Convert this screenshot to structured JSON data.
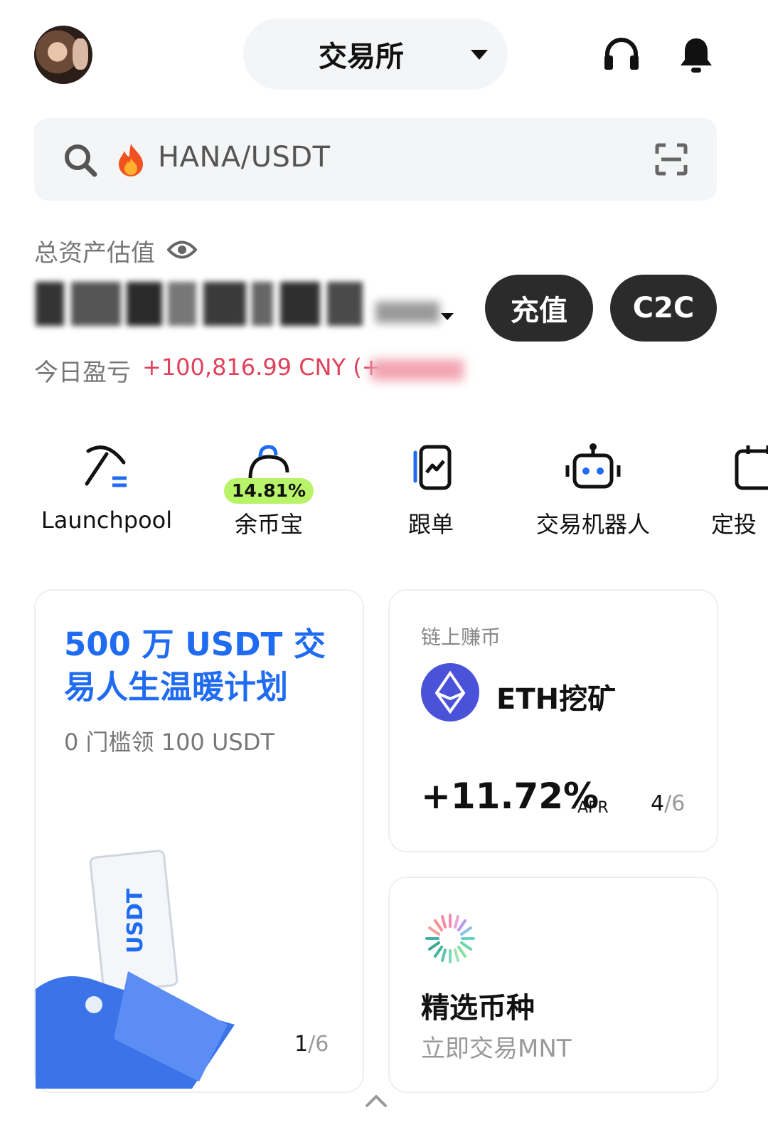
{
  "header": {
    "mode_label": "交易所",
    "icons": [
      "avatar",
      "headset-icon",
      "bell-icon"
    ]
  },
  "search": {
    "text": "HANA/USDT",
    "icons": [
      "search-icon",
      "fire-icon",
      "scan-icon"
    ]
  },
  "assets": {
    "label": "总资产估值",
    "deposit_label": "充值",
    "c2c_label": "C2C",
    "pnl_label": "今日盈亏",
    "pnl_value": "+100,816.99 CNY (+"
  },
  "quick_actions": [
    {
      "label": "Launchpool",
      "icon": "pickaxe-icon"
    },
    {
      "label": "余币宝",
      "icon": "piggy-icon",
      "badge": "14.81%"
    },
    {
      "label": "跟单",
      "icon": "copy-trade-icon"
    },
    {
      "label": "交易机器人",
      "icon": "robot-icon"
    },
    {
      "label": "定投",
      "icon": "calendar-icon"
    }
  ],
  "promo_card": {
    "title": "500 万 USDT 交易人生温暖计划",
    "subtitle": "0 门槛领 100 USDT",
    "card_text": "USDT",
    "page_current": "1",
    "page_total": "/6"
  },
  "mining_card": {
    "category": "链上赚币",
    "title": "ETH挖矿",
    "rate": "+11.72%",
    "rate_unit": "APR",
    "page_current": "4",
    "page_total": "/6"
  },
  "select_card": {
    "title": "精选币种",
    "subtitle": "立即交易MNT"
  },
  "colors": {
    "accent_blue": "#1f6bf2",
    "profit_red": "#e0415b",
    "badge_green": "#b8f36a",
    "button_dark": "#2b2b2b"
  }
}
